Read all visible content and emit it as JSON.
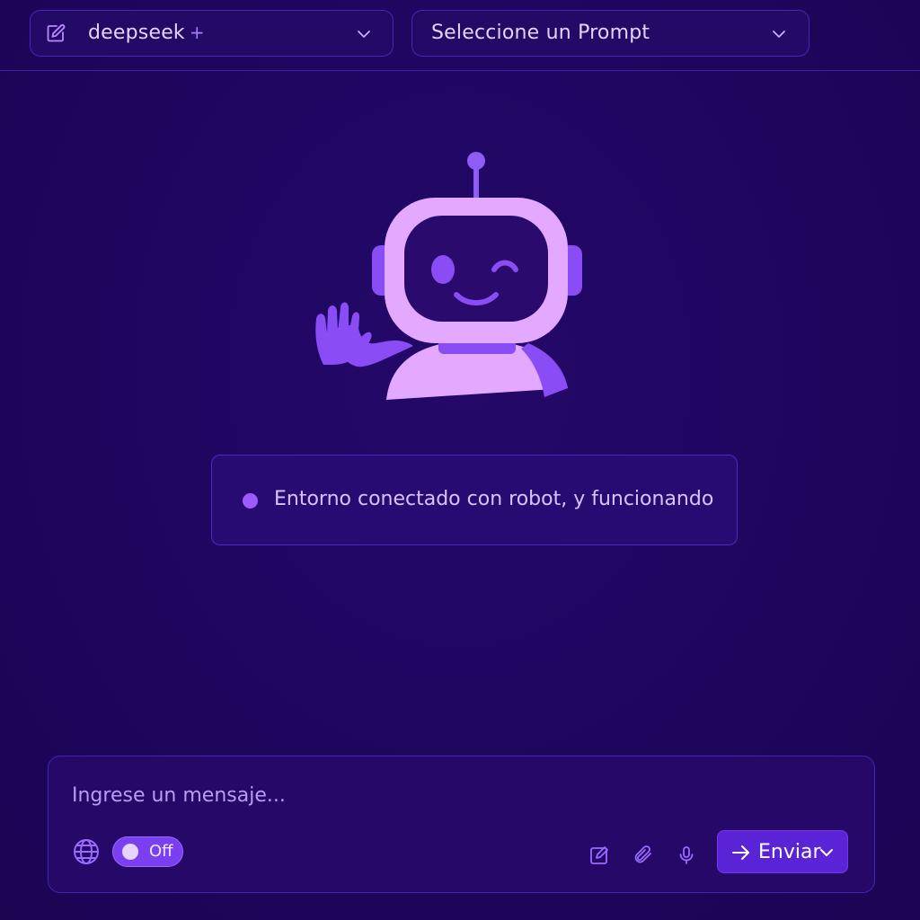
{
  "header": {
    "model_select": {
      "value": "deepseek",
      "suffix": "+",
      "icon": "edit-square-icon"
    },
    "prompt_select": {
      "value": "Seleccione un Prompt",
      "icon": "chevron-down-icon"
    }
  },
  "hero": {
    "illustration": "waving-robot"
  },
  "status": {
    "text": "Entorno conectado con robot, y funcionando",
    "dot_color": "#9b5bff"
  },
  "composer": {
    "placeholder": "Ingrese un mensaje...",
    "value": "",
    "web_toggle": {
      "icon": "globe-icon",
      "state_label": "Off"
    },
    "tools": [
      "edit-icon",
      "attach-icon",
      "mic-icon"
    ],
    "send": {
      "label": "Enviar",
      "icon": "arrow-right-icon"
    }
  },
  "colors": {
    "background": "#1f0660",
    "accent": "#7a3ff0",
    "send_button": "#5a24d6",
    "text": "#e3d4ff"
  }
}
